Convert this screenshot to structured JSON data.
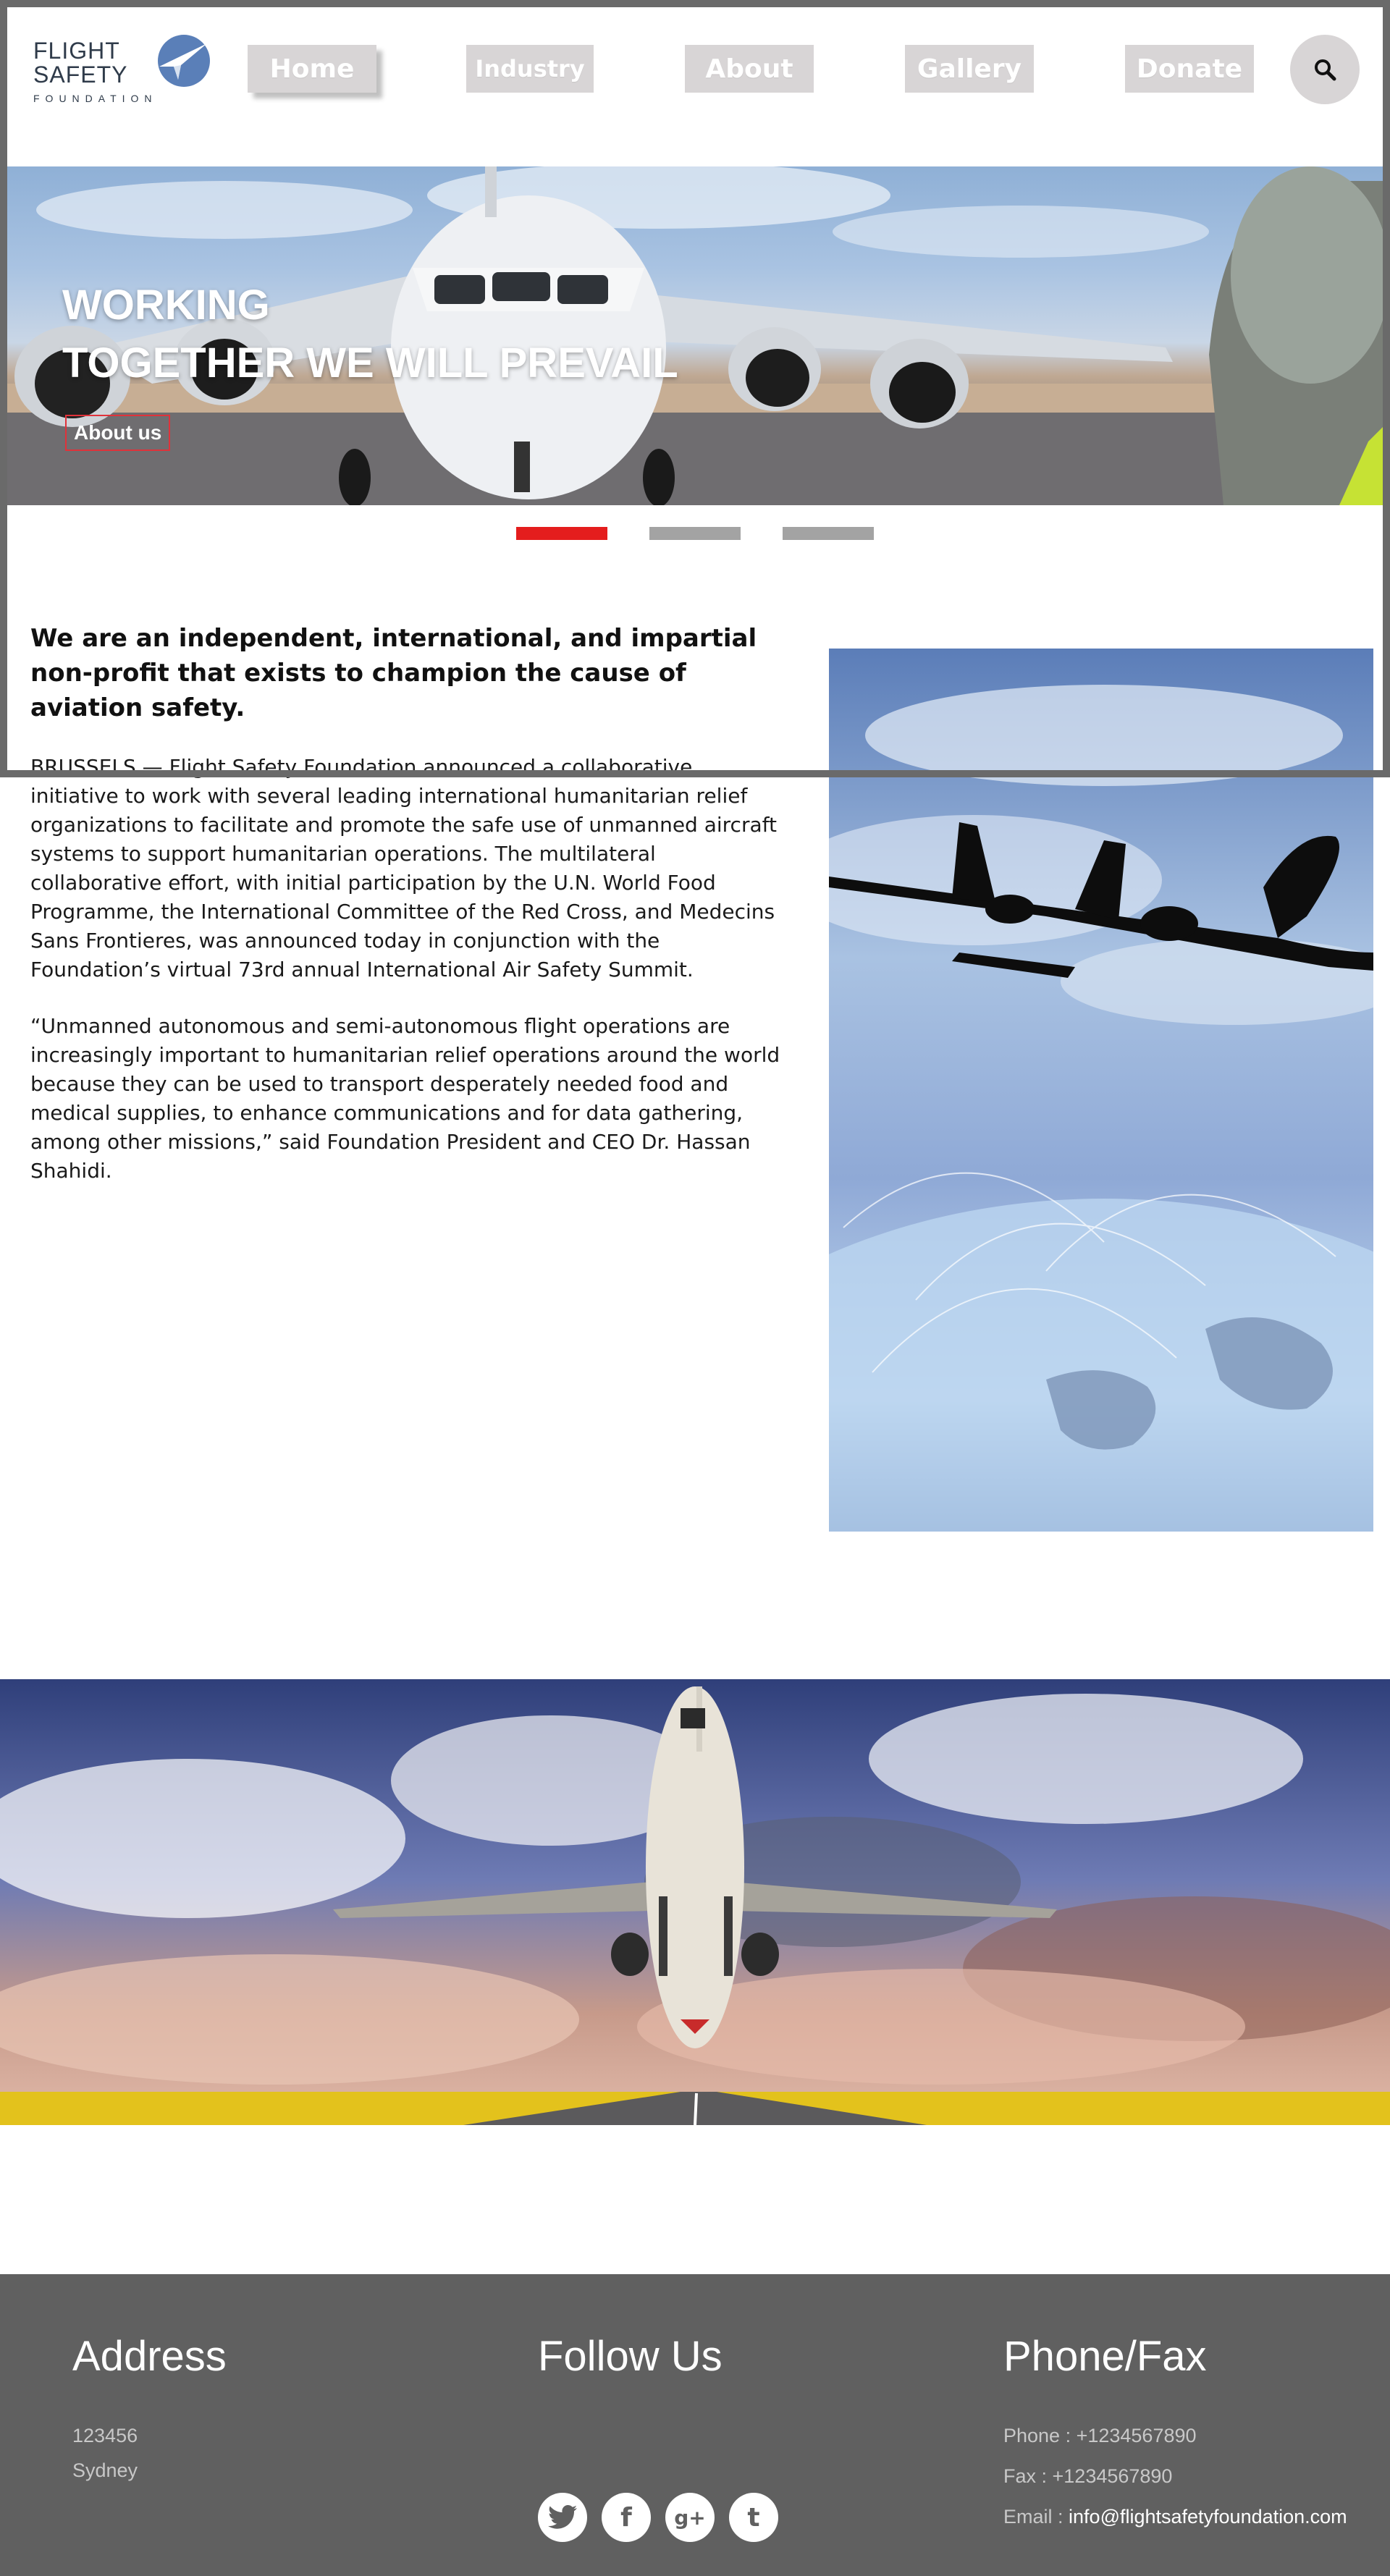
{
  "brand": {
    "logo_line1": "FLIGHT",
    "logo_line2": "SAFETY",
    "logo_sub": "FOUNDATION",
    "logo_color": "#2f3b4a",
    "logo_accent": "#5a7fb8"
  },
  "nav": {
    "items": [
      {
        "label": "Home"
      },
      {
        "label": "Industry"
      },
      {
        "label": "About"
      },
      {
        "label": "Gallery"
      },
      {
        "label": "Donate"
      }
    ],
    "search_icon": "search-icon",
    "button_color": "#d8d5d6"
  },
  "hero": {
    "title_line1": "WORKING",
    "title_line2": "TOGETHER WE WILL PREVAIL",
    "cta_label": "About us",
    "cta_border_color": "#e0323a",
    "slides": [
      {
        "active": true
      },
      {
        "active": false
      },
      {
        "active": false
      }
    ],
    "active_dot_color": "#e41d1d"
  },
  "main": {
    "intro": "We are an independent, international, and impartial non-profit that exists to champion the cause of aviation safety.",
    "paragraph1": "BRUSSELS — Flight Safety Foundation announced a collaborative initiative to work with several leading international humanitarian relief organizations to facilitate and promote the safe use of unmanned aircraft systems to support humanitarian operations. The multilateral collaborative effort, with initial participation by the U.N. World Food Programme, the International Committee of the Red Cross, and Medecins Sans Frontieres, was announced today in conjunction with the Foundation’s virtual 73rd annual International Air Safety Summit.",
    "paragraph2": "“Unmanned autonomous and semi-autonomous flight operations are increasingly important to humanitarian relief operations around the world because they can be used to transport desperately needed food and medical supplies, to enhance communications and for data gathering, among other missions,” said Foundation President and CEO Dr. Hassan Shahidi."
  },
  "footer": {
    "address": {
      "heading": "Address",
      "line1": "123456",
      "line2": "Sydney"
    },
    "follow": {
      "heading": "Follow Us",
      "icons": [
        "twitter-icon",
        "facebook-icon",
        "google-plus-icon",
        "tumblr-icon"
      ],
      "glyphs": [
        "❧",
        "f",
        "g+",
        "t"
      ]
    },
    "phone": {
      "heading": "Phone/Fax",
      "phone_label": "Phone : ",
      "phone_value": "+1234567890",
      "fax_label": "Fax : ",
      "fax_value": "+1234567890",
      "email_label": "Email : ",
      "email_value": "info@flightsafetyfoundation.com"
    },
    "background": "#606060"
  }
}
